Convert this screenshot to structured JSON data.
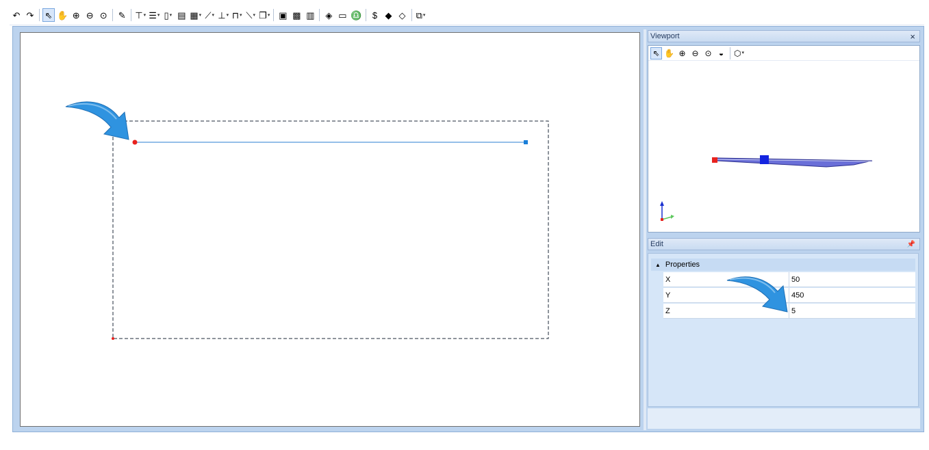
{
  "toolbar": {
    "buttons": [
      {
        "name": "undo-icon",
        "glyph": "↶"
      },
      {
        "name": "redo-icon",
        "glyph": "↷"
      },
      {
        "sep": true
      },
      {
        "name": "select-pointer-icon",
        "glyph": "⇖",
        "active": true
      },
      {
        "name": "pan-hand-icon",
        "glyph": "✋"
      },
      {
        "name": "zoom-window-icon",
        "glyph": "⊕"
      },
      {
        "name": "zoom-out-icon",
        "glyph": "⊖"
      },
      {
        "name": "zoom-extents-icon",
        "glyph": "⊙"
      },
      {
        "sep": true
      },
      {
        "name": "new-drawing-icon",
        "glyph": "✎"
      },
      {
        "sep": true
      },
      {
        "name": "draw-beam-icon",
        "glyph": "⊤",
        "dropdown": true
      },
      {
        "name": "draw-shelf-icon",
        "glyph": "☰",
        "dropdown": true
      },
      {
        "name": "draw-wall-icon",
        "glyph": "▯",
        "dropdown": true
      },
      {
        "name": "layer-properties-icon",
        "glyph": "▤"
      },
      {
        "name": "place-object-icon",
        "glyph": "▦",
        "dropdown": true
      },
      {
        "name": "draw-slope-icon",
        "glyph": "⟋",
        "dropdown": true
      },
      {
        "name": "dimension-icon",
        "glyph": "⊥",
        "dropdown": true
      },
      {
        "name": "frame-icon",
        "glyph": "⊓",
        "dropdown": true
      },
      {
        "name": "draw-line-icon",
        "glyph": "⟍",
        "dropdown": true
      },
      {
        "name": "copy-objects-icon",
        "glyph": "❐",
        "dropdown": true
      },
      {
        "sep": true
      },
      {
        "name": "calculator-icon",
        "glyph": "▣"
      },
      {
        "name": "grid-icon",
        "glyph": "▩"
      },
      {
        "name": "columns-icon",
        "glyph": "▥"
      },
      {
        "sep": true
      },
      {
        "name": "box-3d-icon",
        "glyph": "◈"
      },
      {
        "name": "cylinder-icon",
        "glyph": "▭"
      },
      {
        "name": "weight-icon",
        "glyph": "♎"
      },
      {
        "sep": true
      },
      {
        "name": "cost-icon",
        "glyph": "$"
      },
      {
        "name": "material-icon",
        "glyph": "◆"
      },
      {
        "name": "eraser-icon",
        "glyph": "◇"
      },
      {
        "sep": true
      },
      {
        "name": "window-layout-icon",
        "glyph": "⧉",
        "dropdown": true
      }
    ]
  },
  "canvas": {
    "start_point_color": "#e8221e",
    "end_point_color": "#1a7fd9",
    "line_color": "#2a7fd1"
  },
  "viewport": {
    "title": "Viewport",
    "close_label": "×",
    "tools": [
      {
        "name": "vp-select-icon",
        "glyph": "⇖",
        "active": true
      },
      {
        "name": "vp-pan-icon",
        "glyph": "✋"
      },
      {
        "name": "vp-zoom-window-icon",
        "glyph": "⊕"
      },
      {
        "name": "vp-zoom-out-icon",
        "glyph": "⊖"
      },
      {
        "name": "vp-zoom-extents-icon",
        "glyph": "⊙"
      },
      {
        "name": "vp-orbit-icon",
        "glyph": "◒"
      },
      {
        "sep": true
      },
      {
        "name": "vp-view-cube-icon",
        "glyph": "⬡",
        "dropdown": true
      }
    ]
  },
  "edit": {
    "title": "Edit",
    "pin_label": "📌",
    "section_label": "Properties",
    "properties": [
      {
        "name": "X",
        "value": "50"
      },
      {
        "name": "Y",
        "value": "450"
      },
      {
        "name": "Z",
        "value": "5"
      }
    ]
  },
  "colors": {
    "accent": "#2a7fd1",
    "arrow_blue": "#2f93e0"
  }
}
